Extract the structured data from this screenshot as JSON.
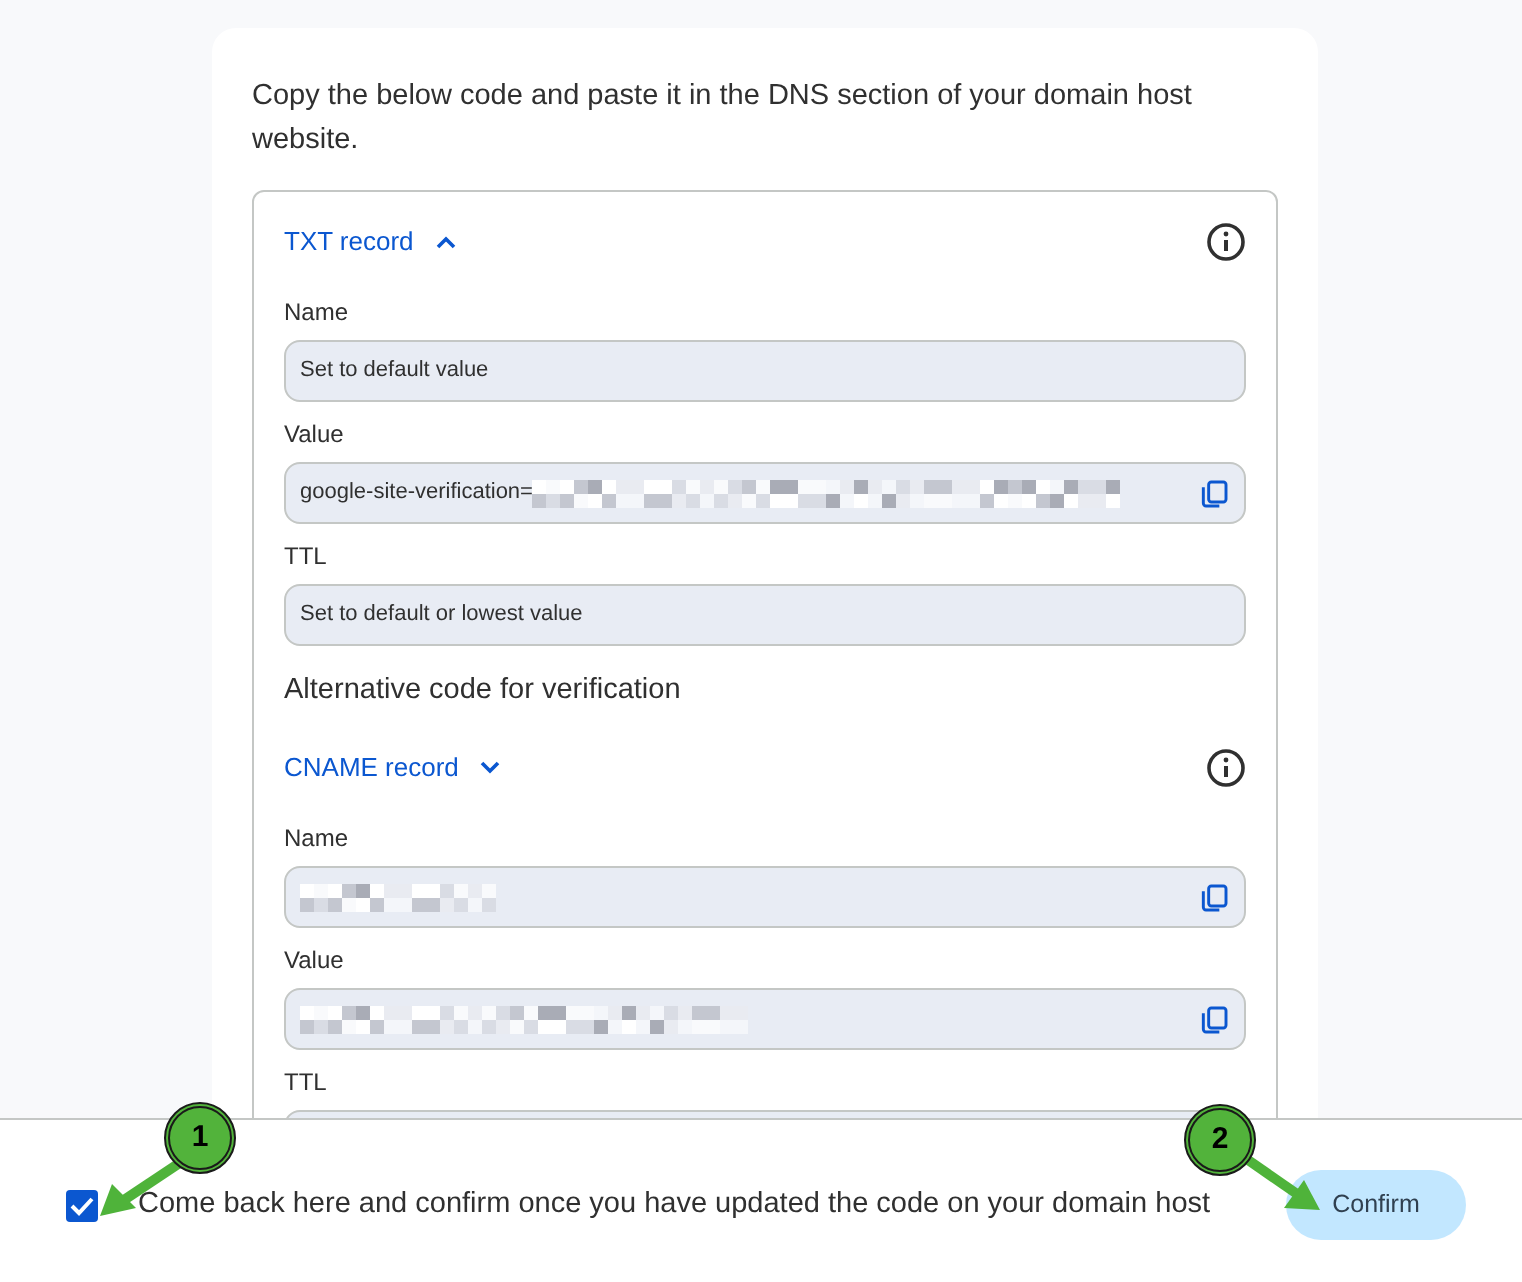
{
  "intro": "Copy the below code and paste it in the DNS section of your domain host website.",
  "txt_record": {
    "title": "TXT record",
    "expanded": true,
    "fields": [
      {
        "label": "Name",
        "value": "Set to default value",
        "redacted": false,
        "copyable": false
      },
      {
        "label": "Value",
        "value": "google-site-verification=",
        "redacted": true,
        "copyable": true
      },
      {
        "label": "TTL",
        "value": "Set to default or lowest value",
        "redacted": false,
        "copyable": false
      }
    ]
  },
  "alternative_heading": "Alternative code for verification",
  "cname_record": {
    "title": "CNAME record",
    "expanded": false,
    "fields": [
      {
        "label": "Name",
        "redacted": true,
        "copyable": true
      },
      {
        "label": "Value",
        "redacted": true,
        "copyable": true
      },
      {
        "label": "TTL"
      }
    ]
  },
  "footer": {
    "checked": true,
    "text": "Come back here and confirm once you have updated the code on your domain host",
    "button": "Confirm"
  },
  "callouts": [
    {
      "label": "1"
    },
    {
      "label": "2"
    }
  ]
}
